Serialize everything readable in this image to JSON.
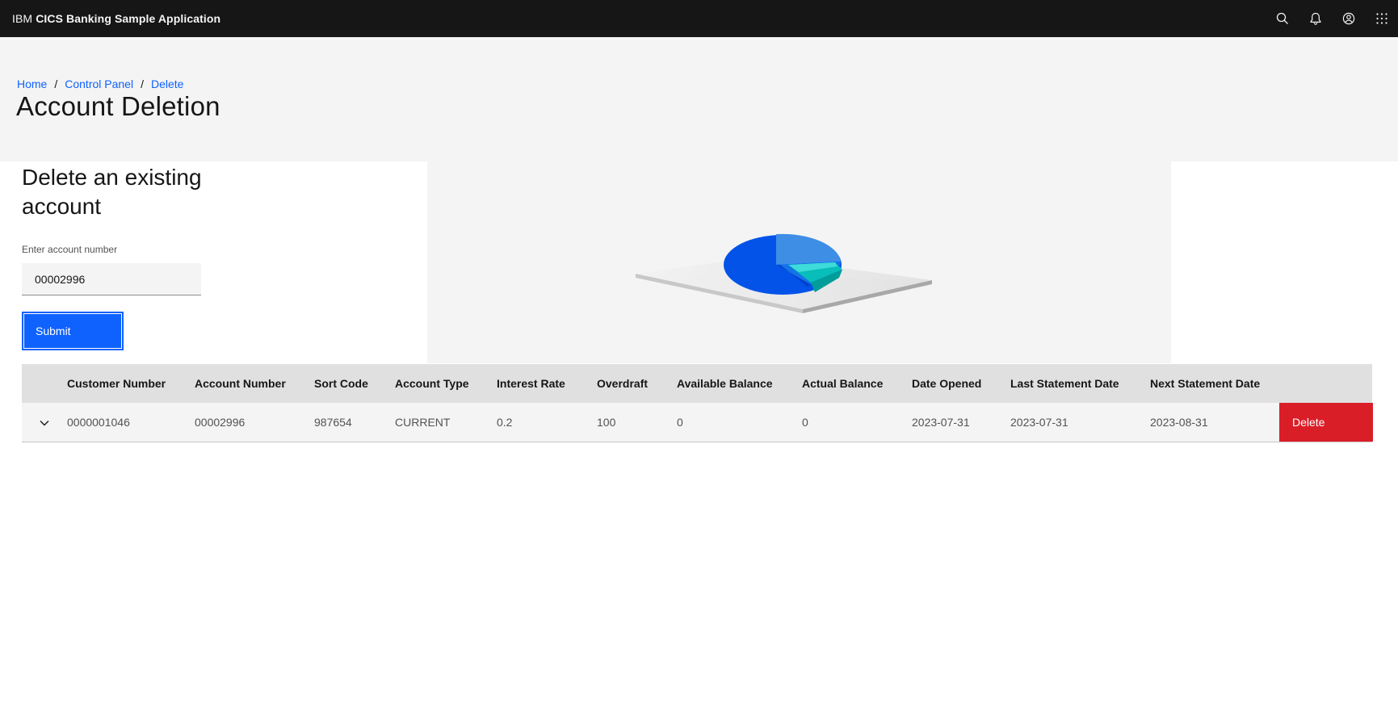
{
  "header": {
    "brand_prefix": "IBM",
    "brand_name": "CICS Banking Sample Application",
    "actions": [
      "search-icon",
      "notification-icon",
      "user-avatar-icon",
      "app-switcher-icon"
    ],
    "background": "#161616"
  },
  "breadcrumb": {
    "items": [
      "Home",
      "Control Panel",
      "Delete"
    ],
    "separator": "/"
  },
  "page": {
    "title": "Account Deletion"
  },
  "form": {
    "title": "Delete an existing account",
    "label": "Enter account number",
    "value": "00002996",
    "submit_label": "Submit"
  },
  "table": {
    "headers": [
      "",
      "Customer Number",
      "Account Number",
      "Sort Code",
      "Account Type",
      "Interest Rate",
      "Overdraft",
      "Available Balance",
      "Actual Balance",
      "Date Opened",
      "Last Statement Date",
      "Next Statement Date",
      ""
    ],
    "rows": [
      {
        "customer_number": "0000001046",
        "account_number": "00002996",
        "sort_code": "987654",
        "account_type": "CURRENT",
        "interest_rate": "0.2",
        "overdraft": "100",
        "available_balance": "0",
        "actual_balance": "0",
        "date_opened": "2023-07-31",
        "last_statement_date": "2023-07-31",
        "next_statement_date": "2023-08-31",
        "delete_label": "Delete"
      }
    ]
  },
  "colors": {
    "primary": "#0f62fe",
    "danger": "#da1e28",
    "surface": "#f4f4f4",
    "header_row": "#e0e0e0"
  }
}
